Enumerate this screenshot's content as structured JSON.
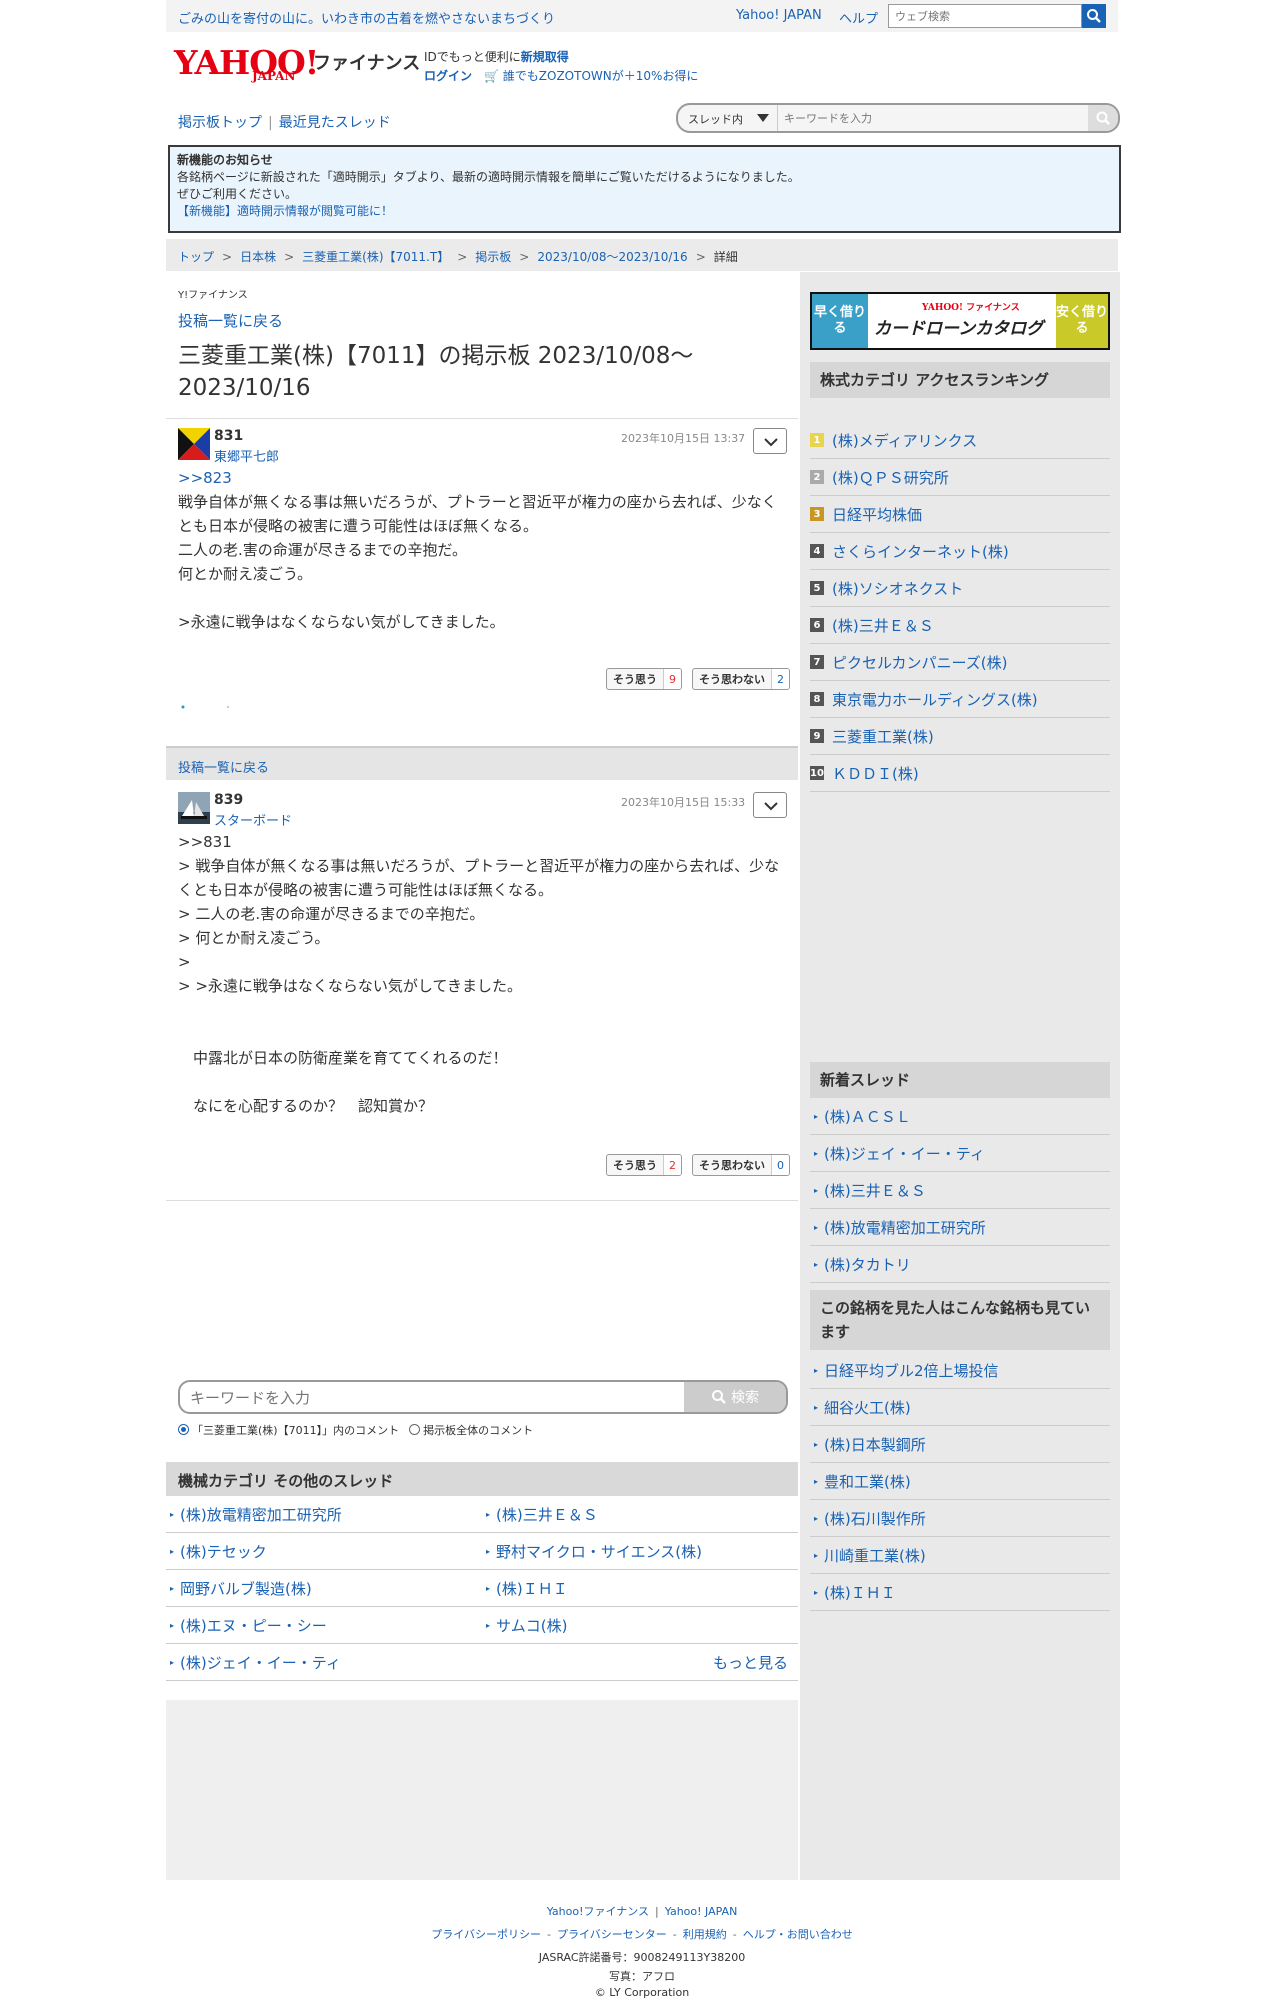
{
  "topbar": {
    "catchphrase": "ごみの山を寄付の山に。いわき市の古着を燃やさないまちづくり",
    "yahoo_japan": "Yahoo! JAPAN",
    "help": "ヘルプ",
    "web_search_placeholder": "ウェブ検索"
  },
  "header": {
    "logo_text": "YAHOO!",
    "logo_sub": "JAPAN",
    "service": "ファイナンス",
    "id_text": "IDでもっと便利に",
    "id_link": "新規取得",
    "login": "ログイン",
    "zozo": "誰でもZOZOTOWNが＋10%お得に"
  },
  "nav": {
    "board_top": "掲示板トップ",
    "separator": "|",
    "recent": "最近見たスレッド",
    "scope_select": "スレッド内",
    "keyword_placeholder": "キーワードを入力"
  },
  "notice": {
    "title": "新機能のお知らせ",
    "line1": "各銘柄ページに新設された「適時開示」タブより、最新の適時開示情報を簡単にご覧いただけるようになりました。",
    "line2": "ぜひご利用ください。",
    "link": "【新機能】適時開示情報が閲覧可能に！"
  },
  "breadcrumb": {
    "items": [
      "トップ",
      "日本株",
      "三菱重工業(株)【7011.T】",
      "掲示板",
      "2023/10/08〜2023/10/16"
    ],
    "current": "詳細",
    "sep": ">"
  },
  "main": {
    "yfin": "Y!ファイナンス",
    "back_link": "投稿一覧に戻る",
    "title": "三菱重工業(株)【7011】の掲示板 2023/10/08〜2023/10/16",
    "back_bar": "投稿一覧に戻る",
    "posts": [
      {
        "number": "831",
        "author": "東郷平七郎",
        "date": "2023年10月15日 13:37",
        "lines": [
          ">>823",
          "戦争自体が無くなる事は無いだろうが、プトラーと習近平が権力の座から去れば、少なくとも日本が侵略の被害に遭う可能性はほぼ無くなる。",
          "二人の老.害の命運が尽きるまでの辛抱だ。",
          "何とか耐え凌ごう。",
          "",
          ">永遠に戦争はなくならない気がしてきました。"
        ],
        "agree_label": "そう思う",
        "agree_count": "9",
        "disagree_label": "そう思わない",
        "disagree_count": "2"
      },
      {
        "number": "839",
        "author": "スターボード",
        "date": "2023年10月15日 15:33",
        "lines": [
          ">>831",
          "> 戦争自体が無くなる事は無いだろうが、プトラーと習近平が権力の座から去れば、少なくとも日本が侵略の被害に遭う可能性はほぼ無くなる。",
          "> 二人の老.害の命運が尽きるまでの辛抱だ。",
          "> 何とか耐え凌ごう。",
          ">",
          "> >永遠に戦争はなくならない気がしてきました。",
          "",
          "",
          "　中露北が日本の防衛産業を育ててくれるのだ！",
          "",
          "　なにを心配するのか？　認知賞か？"
        ],
        "agree_label": "そう思う",
        "agree_count": "2",
        "disagree_label": "そう思わない",
        "disagree_count": "0"
      }
    ],
    "keyword_placeholder": "キーワードを入力",
    "search_button": "検索",
    "scope_this": "「三菱重工業(株)【7011】」内のコメント",
    "scope_all": "掲示板全体のコメント",
    "other_heading": "機械カテゴリ その他のスレッド",
    "other_threads": [
      "(株)放電精密加工研究所",
      "(株)三井Ｅ＆Ｓ",
      "(株)テセック",
      "野村マイクロ・サイエンス(株)",
      "岡野バルブ製造(株)",
      "(株)ＩＨＩ",
      "(株)エヌ・ピー・シー",
      "サムコ(株)",
      "(株)ジェイ・イー・ティ"
    ],
    "more": "もっと見る"
  },
  "side": {
    "banner_left": "早く借りる",
    "banner_logo": "YAHOO! ファイナンス",
    "banner_title": "カードローンカタログ",
    "banner_right": "安く借りる",
    "ranking_heading": "株式カテゴリ アクセスランキング",
    "ranking": [
      "(株)メディアリンクス",
      "(株)ＱＰＳ研究所",
      "日経平均株価",
      "さくらインターネット(株)",
      "(株)ソシオネクスト",
      "(株)三井Ｅ＆Ｓ",
      "ピクセルカンパニーズ(株)",
      "東京電力ホールディングス(株)",
      "三菱重工業(株)",
      "ＫＤＤＩ(株)"
    ],
    "new_heading": "新着スレッド",
    "new_threads": [
      "(株)ＡＣＳＬ",
      "(株)ジェイ・イー・ティ",
      "(株)三井Ｅ＆Ｓ",
      "(株)放電精密加工研究所",
      "(株)タカトリ"
    ],
    "also_heading": "この銘柄を見た人はこんな銘柄も見ています",
    "also_viewed": [
      "日経平均ブル2倍上場投信",
      "細谷火工(株)",
      "(株)日本製鋼所",
      "豊和工業(株)",
      "(株)石川製作所",
      "川崎重工業(株)",
      "(株)ＩＨＩ"
    ]
  },
  "footer": {
    "yfin": "Yahoo!ファイナンス",
    "yj": "Yahoo! JAPAN",
    "links": [
      "プライバシーポリシー",
      "プライバシーセンター",
      "利用規約",
      "ヘルプ・お問い合わせ"
    ],
    "jasrac": "JASRAC許諾番号：9008249113Y38200",
    "photo": "写真：アフロ",
    "copyright": "© LY Corporation"
  }
}
